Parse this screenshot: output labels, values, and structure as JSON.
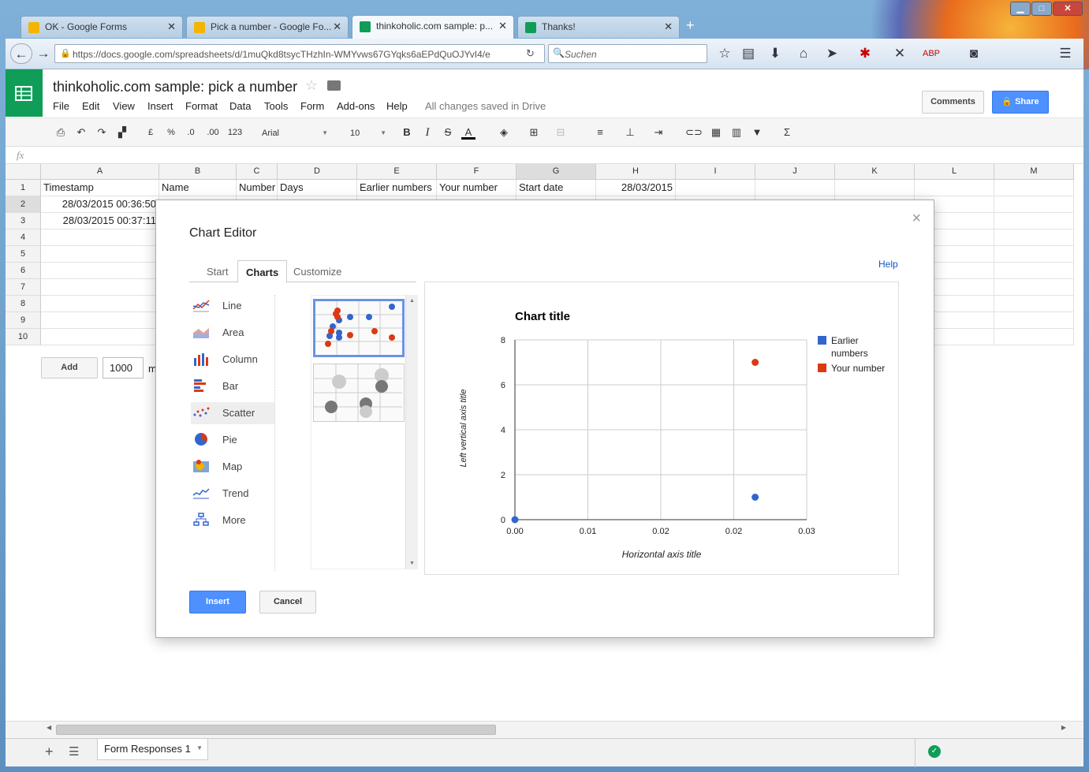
{
  "browser": {
    "tabs": [
      {
        "label": "OK - Google Forms",
        "color": "#f4b400"
      },
      {
        "label": "Pick a number - Google Fo...",
        "color": "#f4b400"
      },
      {
        "label": "thinkoholic.com sample: p...",
        "color": "#0f9d58"
      },
      {
        "label": "Thanks!",
        "color": "#0f9d58"
      }
    ],
    "url": "https://docs.google.com/spreadsheets/d/1muQkd8tsycTHzhIn-WMYvws67GYqks6aEPdQuOJYvI4/e",
    "search_placeholder": "Suchen"
  },
  "doc": {
    "title": "thinkoholic.com sample: pick a number",
    "menu": [
      "File",
      "Edit",
      "View",
      "Insert",
      "Format",
      "Data",
      "Tools",
      "Form",
      "Add-ons",
      "Help"
    ],
    "saved_status": "All changes saved in Drive",
    "comments_label": "Comments",
    "share_label": "Share"
  },
  "toolbar": {
    "currency": "£",
    "percent": "%",
    "dec_less": ".0",
    "dec_more": ".00",
    "numfmt": "123",
    "font": "Arial",
    "size": "10",
    "bold": "B",
    "italic": "I",
    "strike": "S",
    "color": "A"
  },
  "formula": {
    "fx": "fx"
  },
  "sheet": {
    "columns": [
      "A",
      "B",
      "C",
      "D",
      "E",
      "F",
      "G",
      "H",
      "I",
      "J",
      "K",
      "L",
      "M"
    ],
    "rows": [
      "1",
      "2",
      "3",
      "4",
      "5",
      "6",
      "7",
      "8",
      "9",
      "10"
    ],
    "row1": [
      "Timestamp",
      "Name",
      "Number",
      "Days",
      "Earlier numbers",
      "Your number",
      "Start date",
      "28/03/2015"
    ],
    "row2_a": "28/03/2015 00:36:50",
    "row3_a": "28/03/2015 00:37:11",
    "add_label": "Add",
    "add_value": "1000",
    "add_suffix": "m",
    "sheet_tab": "Form Responses 1"
  },
  "dialog": {
    "title": "Chart Editor",
    "help": "Help",
    "tabs": [
      "Start",
      "Charts",
      "Customize"
    ],
    "chart_types": [
      "Line",
      "Area",
      "Column",
      "Bar",
      "Scatter",
      "Pie",
      "Map",
      "Trend",
      "More"
    ],
    "selected_type": "Scatter",
    "insert_label": "Insert",
    "cancel_label": "Cancel"
  },
  "chart_data": {
    "type": "scatter",
    "title": "Chart title",
    "xlabel": "Horizontal axis title",
    "ylabel": "Left vertical axis title",
    "xlim": [
      0,
      0.03
    ],
    "ylim": [
      0,
      8
    ],
    "x_ticks": [
      "0.00",
      "0.01",
      "0.02",
      "0.02",
      "0.03"
    ],
    "y_ticks": [
      "0",
      "2",
      "4",
      "6",
      "8"
    ],
    "grid": true,
    "legend": "right",
    "series": [
      {
        "name": "Earlier numbers",
        "color": "#3366cc",
        "points": [
          [
            0,
            0
          ],
          [
            0.0247,
            1
          ]
        ]
      },
      {
        "name": "Your number",
        "color": "#dc3912",
        "points": [
          [
            0.0247,
            7
          ]
        ]
      }
    ]
  }
}
